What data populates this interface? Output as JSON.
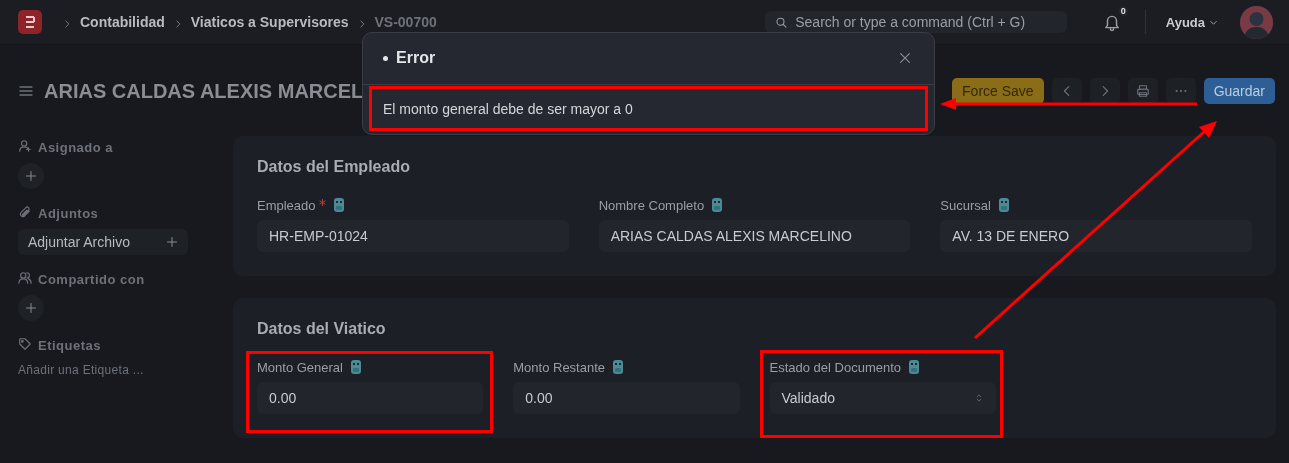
{
  "nav": {
    "breadcrumbs": [
      "Contabilidad",
      "Viaticos a Supervisores",
      "VS-00700"
    ],
    "search": {
      "placeholder": "Search or type a command (Ctrl + G)"
    },
    "notifications": {
      "count": "0"
    },
    "help": "Ayuda"
  },
  "page": {
    "title": "ARIAS CALDAS ALEXIS MARCEL",
    "actions": [
      {
        "kind": "warning",
        "label": "Force Save"
      },
      {
        "kind": "prev"
      },
      {
        "kind": "next"
      },
      {
        "kind": "print"
      },
      {
        "kind": "more"
      },
      {
        "kind": "primary",
        "label": "Guardar"
      }
    ]
  },
  "sidebar": [
    {
      "kind": "assigned",
      "label": "Asignado a"
    },
    {
      "kind": "attachments",
      "label": "Adjuntos",
      "button": "Adjuntar Archivo"
    },
    {
      "kind": "shared",
      "label": "Compartido con"
    },
    {
      "kind": "tags",
      "label": "Etiquetas",
      "placeholder": "Añadir una Etiqueta ..."
    }
  ],
  "sections": [
    {
      "title": "Datos del Empleado",
      "fields": [
        {
          "label": "Empleado",
          "required": true,
          "value": "HR-EMP-01024",
          "kind": "input"
        },
        {
          "label": "Nombre Completo",
          "required": false,
          "value": "ARIAS CALDAS ALEXIS MARCELINO",
          "kind": "input"
        },
        {
          "label": "Sucursal",
          "required": false,
          "value": "AV. 13 DE ENERO",
          "kind": "input"
        }
      ]
    },
    {
      "title": "Datos del Viatico",
      "fields": [
        {
          "label": "Monto General",
          "required": false,
          "value": "0.00",
          "kind": "input"
        },
        {
          "label": "Monto Restante",
          "required": false,
          "value": "0.00",
          "kind": "input"
        },
        {
          "label": "Estado del Documento",
          "required": false,
          "value": "Validado",
          "kind": "select"
        }
      ]
    }
  ],
  "dialog": {
    "title": "Error",
    "message": "El monto general debe de ser mayor a 0"
  }
}
